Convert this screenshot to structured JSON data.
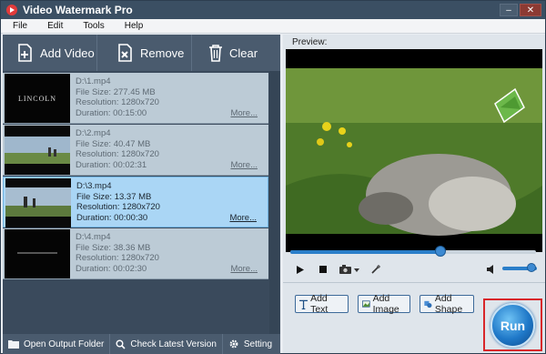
{
  "window": {
    "title": "Video Watermark Pro",
    "minimize": "–",
    "close": "✕"
  },
  "menu": [
    "File",
    "Edit",
    "Tools",
    "Help"
  ],
  "toolbar": {
    "add_video": "Add Video",
    "remove": "Remove",
    "clear": "Clear"
  },
  "files": [
    {
      "name": "D:\\1.mp4",
      "size": "File Size: 277.45 MB",
      "resolution": "Resolution: 1280x720",
      "duration": "Duration: 00:15:00",
      "more": "More...",
      "thumb_text": "LINCOLN",
      "selected": false
    },
    {
      "name": "D:\\2.mp4",
      "size": "File Size: 40.47 MB",
      "resolution": "Resolution: 1280x720",
      "duration": "Duration: 00:02:31",
      "more": "More...",
      "selected": false
    },
    {
      "name": "D:\\3.mp4",
      "size": "File Size: 13.37 MB",
      "resolution": "Resolution: 1280x720",
      "duration": "Duration: 00:00:30",
      "more": "More...",
      "selected": true
    },
    {
      "name": "D:\\4.mp4",
      "size": "File Size: 38.36 MB",
      "resolution": "Resolution: 1280x720",
      "duration": "Duration: 00:02:30",
      "more": "More...",
      "selected": false
    }
  ],
  "bottom": {
    "open_output": "Open Output Folder",
    "check_version": "Check Latest Version",
    "setting": "Setting"
  },
  "preview": {
    "label": "Preview:",
    "progress": 0.61,
    "volume": 0.85
  },
  "watermark": {
    "add_text": "Add Text",
    "add_image": "Add Image",
    "add_shape": "Add Shape"
  },
  "run": {
    "label": "Run"
  },
  "colors": {
    "accent": "#2a7ec9",
    "highlight_frame": "#d8262a",
    "selected_row": "#aad6f5"
  }
}
